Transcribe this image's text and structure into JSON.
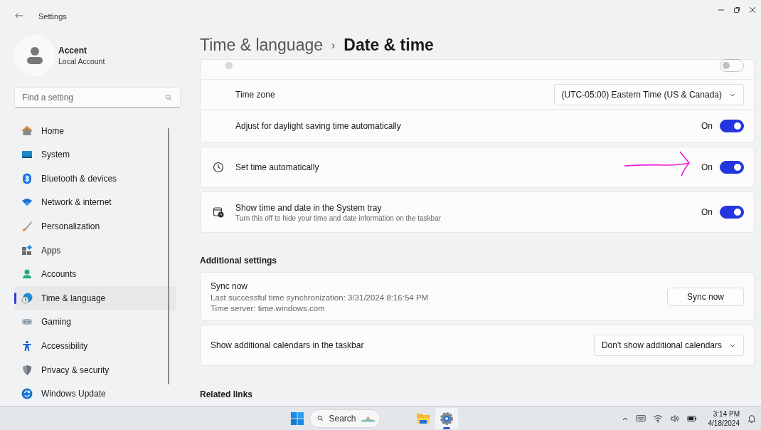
{
  "window": {
    "title": "Settings"
  },
  "account": {
    "name": "Accent",
    "type": "Local Account"
  },
  "search": {
    "placeholder": "Find a setting"
  },
  "sidebar": {
    "items": [
      {
        "label": "Home",
        "selected": false
      },
      {
        "label": "System",
        "selected": false
      },
      {
        "label": "Bluetooth & devices",
        "selected": false
      },
      {
        "label": "Network & internet",
        "selected": false
      },
      {
        "label": "Personalization",
        "selected": false
      },
      {
        "label": "Apps",
        "selected": false
      },
      {
        "label": "Accounts",
        "selected": false
      },
      {
        "label": "Time & language",
        "selected": true
      },
      {
        "label": "Gaming",
        "selected": false
      },
      {
        "label": "Accessibility",
        "selected": false
      },
      {
        "label": "Privacy & security",
        "selected": false
      },
      {
        "label": "Windows Update",
        "selected": false
      }
    ]
  },
  "breadcrumb": {
    "parent": "Time & language",
    "separator": "›",
    "current": "Date & time"
  },
  "groups": [
    {
      "rows": [
        {
          "kind": "obscured",
          "on": false
        },
        {
          "kind": "dropdown",
          "label": "Time zone",
          "value": "(UTC-05:00) Eastern Time (US & Canada)"
        },
        {
          "kind": "toggle",
          "label": "Adjust for daylight saving time automatically",
          "state_label": "On",
          "on": true
        }
      ]
    },
    {
      "rows": [
        {
          "kind": "icon_toggle",
          "label": "Set time automatically",
          "state_label": "On",
          "on": true,
          "annotated": true
        }
      ]
    },
    {
      "rows": [
        {
          "kind": "icon_toggle",
          "label": "Show time and date in the System tray",
          "description": "Turn this off to hide your time and date information on the taskbar",
          "state_label": "On",
          "on": true
        }
      ]
    }
  ],
  "additional": {
    "heading": "Additional settings",
    "groups": [
      {
        "rows": [
          {
            "kind": "sync",
            "label": "Sync now",
            "lines": [
              "Last successful time synchronization: 3/31/2024 8:16:54 PM",
              "Time server: time.windows.com"
            ],
            "button": "Sync now"
          }
        ]
      },
      {
        "rows": [
          {
            "kind": "dropdown",
            "label": "Show additional calendars in the taskbar",
            "value": "Don't show additional calendars"
          }
        ]
      }
    ]
  },
  "related": {
    "heading": "Related links"
  },
  "taskbar": {
    "search": "Search",
    "apps": [
      {
        "selected": false
      },
      {
        "selected": true
      }
    ],
    "clock": {
      "time": "3:14 PM",
      "date": "4/18/2024"
    }
  }
}
